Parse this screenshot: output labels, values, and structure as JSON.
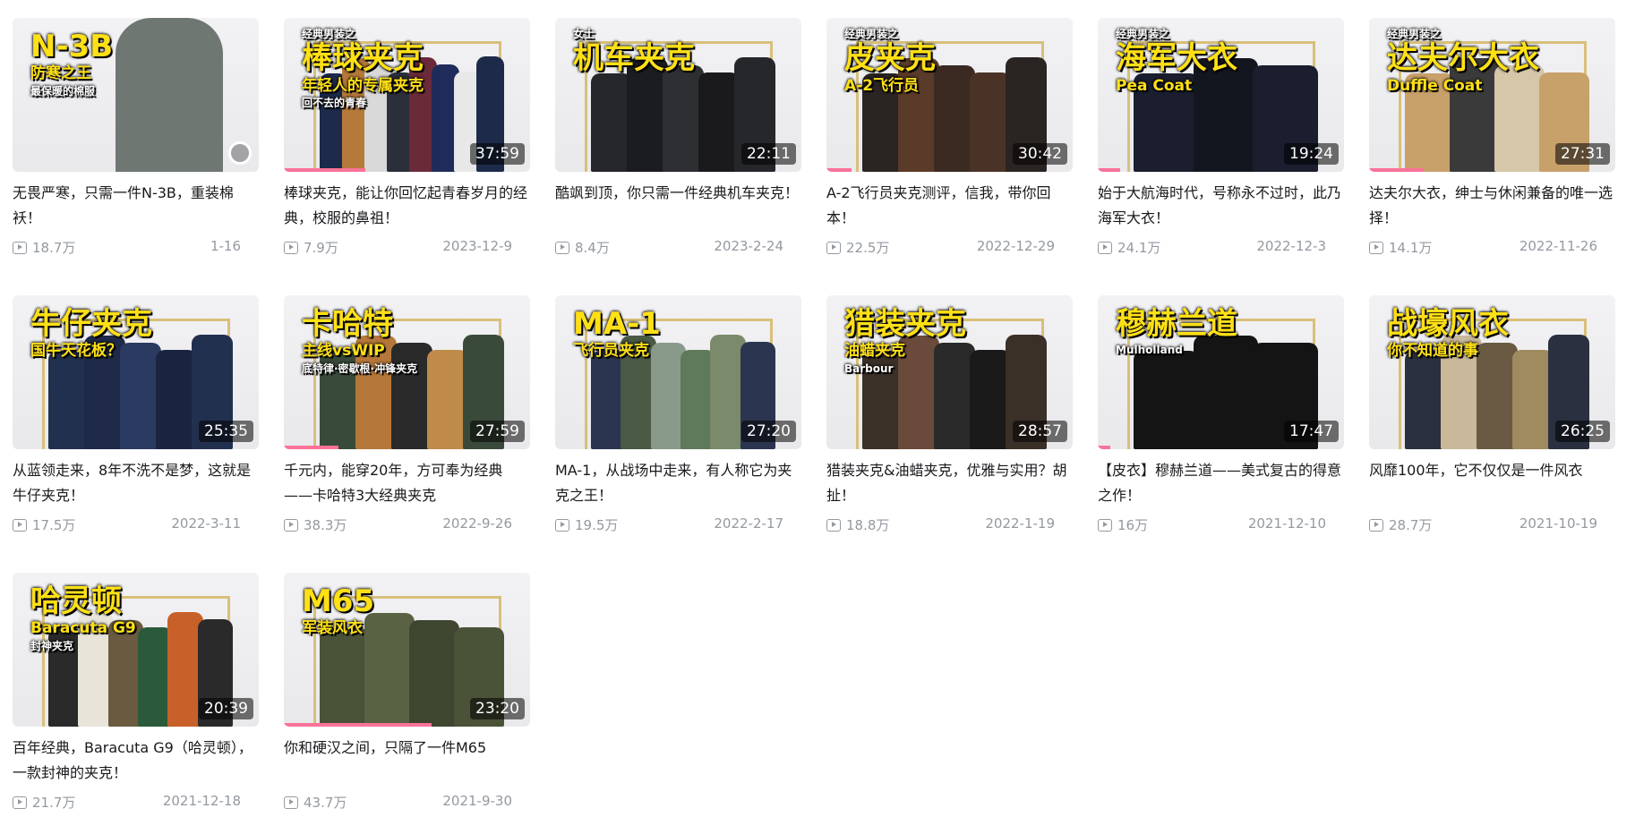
{
  "videos": [
    {
      "title": "无畏严寒，只需一件N-3B，重装棉袄！",
      "views": "18.7万",
      "date": "1-16",
      "duration": "",
      "overlay_main": "N-3B",
      "overlay_sub": "防寒之王",
      "overlay_small": "最保暖的棉服",
      "overlay_top": "",
      "progress": 0,
      "palette": [
        "#6f7773"
      ],
      "kind": "person"
    },
    {
      "title": "棒球夹克，能让你回忆起青春岁月的经典，校服的鼻祖！",
      "views": "7.9万",
      "date": "2023-12-9",
      "duration": "37:59",
      "overlay_main": "棒球夹克",
      "overlay_sub": "年轻人的专属夹克",
      "overlay_small": "回不去的青春",
      "overlay_top": "经典男装之",
      "progress": 0.33,
      "palette": [
        "#1d2a4a",
        "#b57a3a",
        "#d9d9d9",
        "#2a2f3a",
        "#6b2a3a",
        "#1f2b5a",
        "#e8e8e8"
      ],
      "kind": "rack"
    },
    {
      "title": "酷飒到顶，你只需一件经典机车夹克！",
      "views": "8.4万",
      "date": "2023-2-24",
      "duration": "22:11",
      "overlay_main": "机车夹克",
      "overlay_sub": "",
      "overlay_small": "",
      "overlay_top": "女士",
      "progress": 0,
      "palette": [
        "#26272b",
        "#1b1c20",
        "#2e2f33",
        "#1a1a1d"
      ],
      "kind": "rack"
    },
    {
      "title": "A-2飞行员夹克测评，信我，带你回本！",
      "views": "22.5万",
      "date": "2022-12-29",
      "duration": "30:42",
      "overlay_main": "皮夹克",
      "overlay_sub": "A-2飞行员",
      "overlay_small": "",
      "overlay_top": "经典男装之",
      "progress": 0.1,
      "palette": [
        "#2a2422",
        "#5a3a28",
        "#3a2a22",
        "#4a3326"
      ],
      "kind": "rack"
    },
    {
      "title": "始于大航海时代，号称永不过时，此乃海军大衣！",
      "views": "24.1万",
      "date": "2022-12-3",
      "duration": "19:24",
      "overlay_main": "海军大衣",
      "overlay_sub": "Pea Coat",
      "overlay_small": "",
      "overlay_top": "经典男装之",
      "progress": 0.09,
      "palette": [
        "#1a1e2e",
        "#14161f"
      ],
      "kind": "rack"
    },
    {
      "title": "达夫尔大衣，绅士与休闲兼备的唯一选择！",
      "views": "14.1万",
      "date": "2022-11-26",
      "duration": "27:31",
      "overlay_main": "达夫尔大衣",
      "overlay_sub": "Duffle Coat",
      "overlay_small": "",
      "overlay_top": "经典男装之",
      "progress": 0.22,
      "palette": [
        "#c8a06a",
        "#3a3a3a",
        "#d5c7a8"
      ],
      "kind": "rack"
    },
    {
      "title": "从蓝领走来，8年不洗不是梦，这就是牛仔夹克！",
      "views": "17.5万",
      "date": "2022-3-11",
      "duration": "25:35",
      "overlay_main": "牛仔夹克",
      "overlay_sub": "国牛天花板？",
      "overlay_small": "",
      "overlay_top": "",
      "progress": 0,
      "palette": [
        "#22304f",
        "#1e2a47",
        "#2b3a60",
        "#1a2440"
      ],
      "kind": "rack"
    },
    {
      "title": "千元内，能穿20年，方可奉为经典——卡哈特3大经典夹克",
      "views": "38.3万",
      "date": "2022-9-26",
      "duration": "27:59",
      "overlay_main": "卡哈特",
      "overlay_sub": "主线vsWIP",
      "overlay_small": "底特律·密歇根·冲锋夹克",
      "overlay_top": "",
      "progress": 0.22,
      "palette": [
        "#3a4a3a",
        "#b5783a",
        "#2a2a2a",
        "#c08a4a"
      ],
      "kind": "rack"
    },
    {
      "title": "MA-1，从战场中走来，有人称它为夹克之王！",
      "views": "19.5万",
      "date": "2022-2-17",
      "duration": "27:20",
      "overlay_main": "MA-1",
      "overlay_sub": "飞行员夹克",
      "overlay_small": "",
      "overlay_top": "",
      "progress": 0,
      "palette": [
        "#2b3550",
        "#4a5a44",
        "#8a9a8a",
        "#5f7a5a",
        "#7a8a6a"
      ],
      "kind": "rack"
    },
    {
      "title": "猎装夹克&油蜡夹克，优雅与实用？胡扯！",
      "views": "18.8万",
      "date": "2022-1-19",
      "duration": "28:57",
      "overlay_main": "猎装夹克",
      "overlay_sub": "油蜡夹克",
      "overlay_small": "Barbour",
      "overlay_top": "",
      "progress": 0,
      "palette": [
        "#3a3028",
        "#6a4a3a",
        "#2a2a2a",
        "#1a1a1a"
      ],
      "kind": "rack"
    },
    {
      "title": "【皮衣】穆赫兰道——美式复古的得意之作！",
      "views": "16万",
      "date": "2021-12-10",
      "duration": "17:47",
      "overlay_main": "穆赫兰道",
      "overlay_sub": "",
      "overlay_small": "Mulholland",
      "overlay_top": "",
      "progress": 0.05,
      "palette": [
        "#141414"
      ],
      "kind": "rack"
    },
    {
      "title": "风靡100年，它不仅仅是一件风衣",
      "views": "28.7万",
      "date": "2021-10-19",
      "duration": "26:25",
      "overlay_main": "战壕风衣",
      "overlay_sub": "你不知道的事",
      "overlay_small": "",
      "overlay_top": "",
      "progress": 0,
      "palette": [
        "#2a3040",
        "#c9b89a",
        "#6a5a44",
        "#a08a60"
      ],
      "kind": "rack"
    },
    {
      "title": "百年经典，Baracuta G9（哈灵顿），一款封神的夹克！",
      "views": "21.7万",
      "date": "2021-12-18",
      "duration": "20:39",
      "overlay_main": "哈灵顿",
      "overlay_sub": "Baracuta G9",
      "overlay_small": "封神夹克",
      "overlay_top": "",
      "progress": 0,
      "palette": [
        "#2a2a2a",
        "#e8e4da",
        "#6a5a40",
        "#2a5a3a",
        "#c8602a"
      ],
      "kind": "rack"
    },
    {
      "title": "你和硬汉之间，只隔了一件M65",
      "views": "43.7万",
      "date": "2021-9-30",
      "duration": "23:20",
      "overlay_main": "M65",
      "overlay_sub": "军装风衣",
      "overlay_small": "",
      "overlay_top": "",
      "progress": 0.6,
      "palette": [
        "#4a5238",
        "#5a6244",
        "#3e4630"
      ],
      "kind": "rack"
    }
  ]
}
